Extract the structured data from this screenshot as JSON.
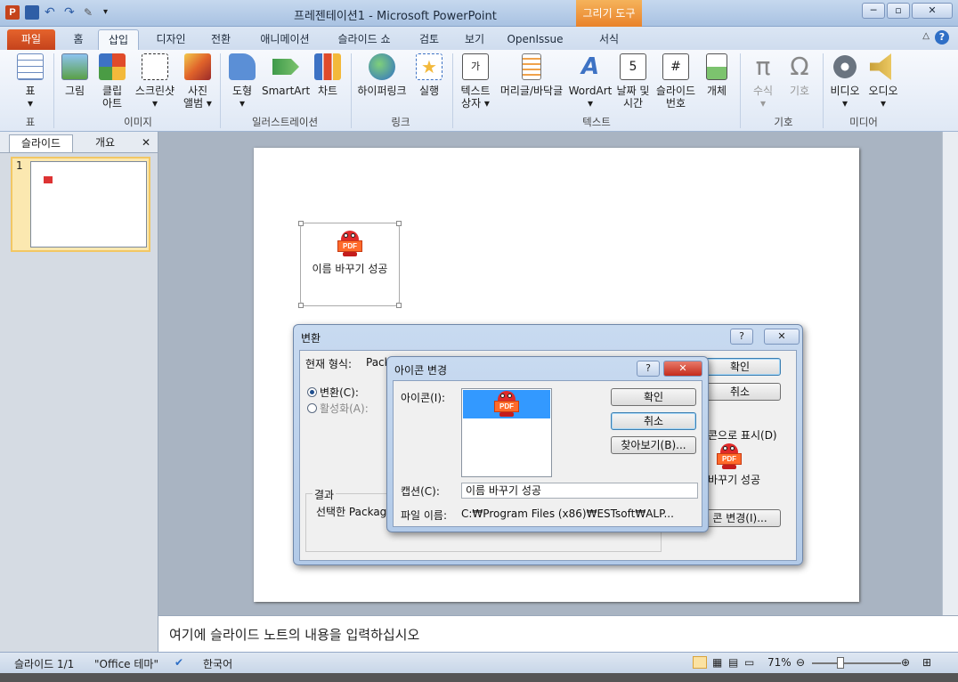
{
  "app": {
    "title": "프레젠테이션1 - Microsoft PowerPoint",
    "contextual_tool": "그리기 도구",
    "app_icon_letter": "P"
  },
  "tabs": [
    "파일",
    "홈",
    "삽입",
    "디자인",
    "전환",
    "애니메이션",
    "슬라이드 쇼",
    "검토",
    "보기",
    "OpenIssue",
    "서식"
  ],
  "active_tab": "삽입",
  "ribbon": {
    "buttons": [
      {
        "label": "표",
        "sub": "▾"
      },
      {
        "label": "그림",
        "sub": ""
      },
      {
        "label": "클립",
        "sub": "아트"
      },
      {
        "label": "스크린샷",
        "sub": "▾"
      },
      {
        "label": "사진",
        "sub": "앨범 ▾"
      },
      {
        "label": "도형",
        "sub": "▾"
      },
      {
        "label": "SmartArt",
        "sub": ""
      },
      {
        "label": "차트",
        "sub": ""
      },
      {
        "label": "하이퍼링크",
        "sub": ""
      },
      {
        "label": "실행",
        "sub": ""
      },
      {
        "label": "텍스트",
        "sub": "상자 ▾"
      },
      {
        "label": "머리글/바닥글",
        "sub": ""
      },
      {
        "label": "WordArt",
        "sub": "▾"
      },
      {
        "label": "날짜 및",
        "sub": "시간"
      },
      {
        "label": "슬라이드",
        "sub": "번호"
      },
      {
        "label": "개체",
        "sub": ""
      },
      {
        "label": "수식",
        "sub": "▾"
      },
      {
        "label": "기호",
        "sub": ""
      },
      {
        "label": "비디오",
        "sub": "▾"
      },
      {
        "label": "오디오",
        "sub": "▾"
      }
    ],
    "groups": [
      "표",
      "이미지",
      "일러스트레이션",
      "링크",
      "텍스트",
      "기호",
      "미디어"
    ]
  },
  "left_pane": {
    "tab_slides": "슬라이드",
    "tab_outline": "개요",
    "close": "✕",
    "slide_number": "1"
  },
  "slide_object": {
    "caption": "이름 바꾸기 성공",
    "icon_text": "PDF"
  },
  "notes_placeholder": "여기에 슬라이드 노트의 내용을 입력하십시오",
  "status": {
    "slide": "슬라이드 1/1",
    "theme": "\"Office 테마\"",
    "language": "한국어",
    "zoom": "71%"
  },
  "convert_dialog": {
    "title": "변환",
    "current_format_label": "현재 형식:",
    "current_format_value": "Pack",
    "convert_radio": "변환(C):",
    "activate_radio": "활성화(A):",
    "result_label": "결과",
    "result_text": "선택한 Packag",
    "ok": "확인",
    "cancel": "취소",
    "display_as_icon": "콘으로 표시(D)",
    "icon_caption": "바꾸기 성공",
    "change_icon": "콘 변경(I)..."
  },
  "change_icon_dialog": {
    "title": "아이콘 변경",
    "icon_label": "아이콘(I):",
    "ok": "확인",
    "cancel": "취소",
    "browse": "찾아보기(B)...",
    "caption_label": "캡션(C):",
    "caption_value": "이름 바꾸기 성공",
    "filename_label": "파일 이름:",
    "filename_value": "C:₩Program Files (x86)₩ESTsoft₩ALP..."
  }
}
